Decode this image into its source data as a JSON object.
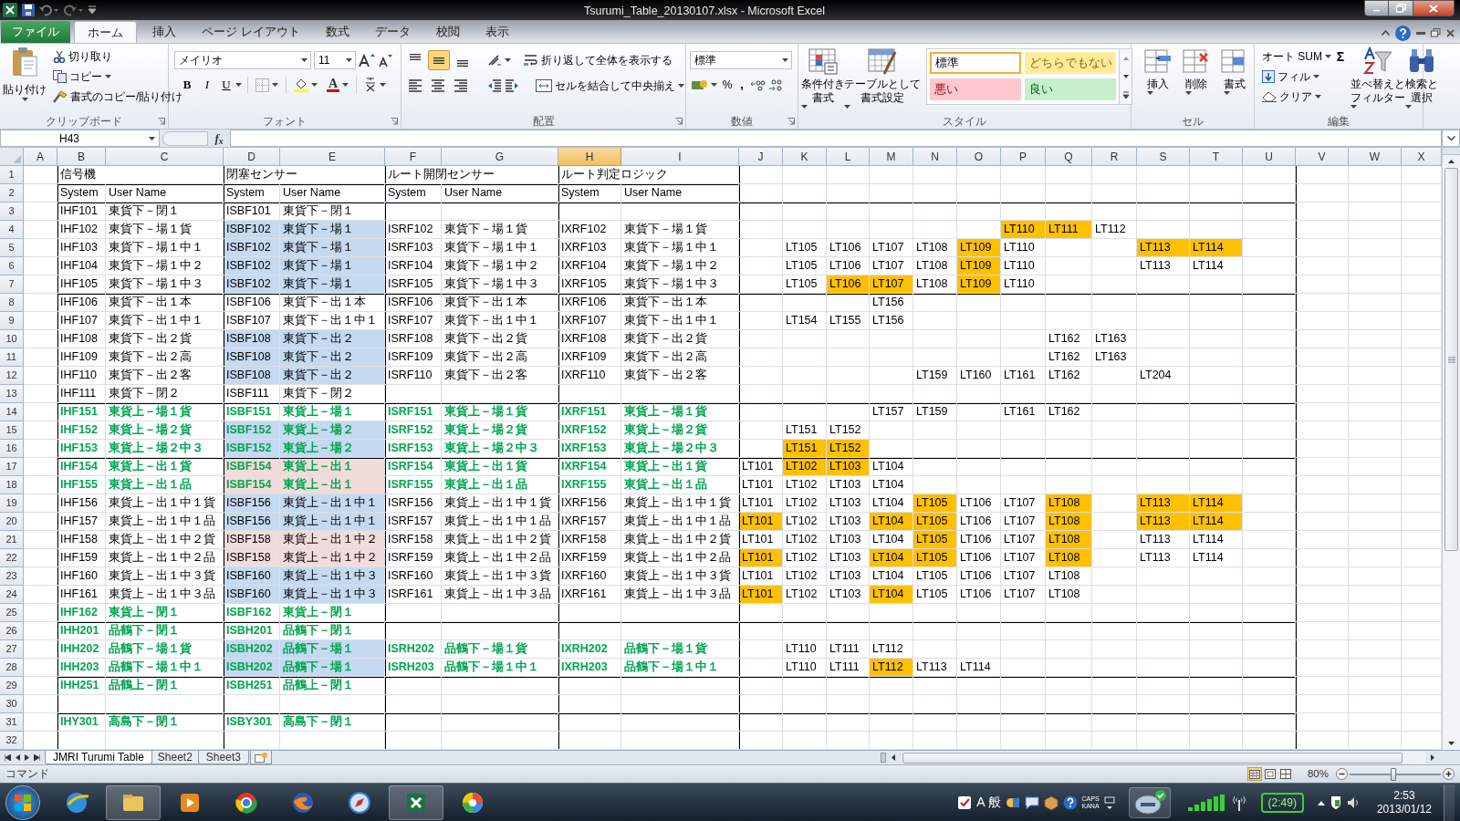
{
  "window": {
    "title": "Tsurumi_Table_20130107.xlsx  -  Microsoft Excel"
  },
  "tabs": [
    {
      "label": "ファイル",
      "selected": false,
      "kind": "file"
    },
    {
      "label": "ホーム",
      "selected": true
    },
    {
      "label": "挿入",
      "selected": false
    },
    {
      "label": "ページ レイアウト",
      "selected": false
    },
    {
      "label": "数式",
      "selected": false
    },
    {
      "label": "データ",
      "selected": false
    },
    {
      "label": "校閲",
      "selected": false
    },
    {
      "label": "表示",
      "selected": false
    }
  ],
  "ribbon": {
    "clipboard": {
      "label": "クリップボード",
      "paste": "貼り付け",
      "cut": "切り取り",
      "copy": "コピー",
      "painter": "書式のコピー/貼り付け"
    },
    "font": {
      "label": "フォント",
      "name": "メイリオ",
      "size": "11",
      "bold": "B",
      "italic": "I",
      "underline": "U",
      "color_letter": "A"
    },
    "alignment": {
      "label": "配置",
      "wrap": "折り返して全体を表示する",
      "merge": "セルを結合して中央揃え",
      "middle_on": true
    },
    "number": {
      "label": "数値",
      "format": "標準",
      "percent": "%",
      "comma": ","
    },
    "styles": {
      "label": "スタイル",
      "conditional": [
        "条件付き",
        "書式"
      ],
      "table": [
        "テーブルとして",
        "書式設定"
      ],
      "gallery": [
        {
          "text": "標準",
          "color": "#ffffff",
          "kind": "normal",
          "selected": true
        },
        {
          "text": "どちらでもない",
          "color": "#ffeb9c",
          "kind": "neutral",
          "selected": false
        },
        {
          "text": "悪い",
          "color": "#ffc7ce",
          "kind": "bad",
          "selected": false
        },
        {
          "text": "良い",
          "color": "#c6efce",
          "kind": "good",
          "selected": false
        }
      ]
    },
    "cells": {
      "label": "セル",
      "insert": "挿入",
      "delete": "削除",
      "format": "書式"
    },
    "editing": {
      "label": "編集",
      "sigma": "Σ",
      "autosum": "オート SUM",
      "fill": "フィル",
      "clear": "クリア",
      "sort": [
        "並べ替えと",
        "フィルター"
      ],
      "find": [
        "検索と",
        "選択"
      ]
    }
  },
  "formula_bar": {
    "name_box": "H43",
    "fx": "f$_{x}$"
  },
  "columns": [
    {
      "label": "A",
      "selected": false
    },
    {
      "label": "B",
      "selected": false,
      "rule_left": true
    },
    {
      "label": "C",
      "selected": false
    },
    {
      "label": "D",
      "selected": false,
      "rule_left": true
    },
    {
      "label": "E",
      "selected": false
    },
    {
      "label": "F",
      "selected": false,
      "rule_left": true
    },
    {
      "label": "G",
      "selected": false
    },
    {
      "label": "H",
      "selected": true,
      "rule_left": true
    },
    {
      "label": "I",
      "selected": false
    },
    {
      "label": "J",
      "selected": false,
      "rule_left": true
    },
    {
      "label": "K",
      "selected": false
    },
    {
      "label": "L",
      "selected": false
    },
    {
      "label": "M",
      "selected": false
    },
    {
      "label": "N",
      "selected": false
    },
    {
      "label": "O",
      "selected": false
    },
    {
      "label": "P",
      "selected": false
    },
    {
      "label": "Q",
      "selected": false
    },
    {
      "label": "R",
      "selected": false
    },
    {
      "label": "S",
      "selected": false
    },
    {
      "label": "T",
      "selected": false
    },
    {
      "label": "U",
      "selected": false
    },
    {
      "label": "V",
      "selected": false,
      "rule_left": true
    },
    {
      "label": "W",
      "selected": false
    },
    {
      "label": "X",
      "selected": false
    }
  ],
  "rows": [
    {
      "num": "1",
      "kind": "title",
      "cells": [
        null,
        "信号機",
        null,
        "閉塞センサー",
        null,
        "ルート開閉センサー",
        null,
        "ルート判定ロジック"
      ]
    },
    {
      "num": "2",
      "kind": "header",
      "rule_above": true,
      "cells": [
        null,
        "System",
        "User Name",
        "System",
        "User Name",
        "System",
        "User Name",
        "System",
        "User Name"
      ]
    },
    {
      "num": "3",
      "rule_above": true,
      "cells": [
        null,
        "IHF101",
        "東貨下－閉１",
        "ISBF101",
        "東貨下－閉１"
      ]
    },
    {
      "num": "4",
      "cells": [
        null,
        "IHF102",
        "東貨下－場１貨",
        {
          "text": "ISBF102",
          "color": "#c5d9f1"
        },
        {
          "text": "東貨下－場１",
          "color": "#c5d9f1"
        },
        "ISRF102",
        "東貨下－場１貨",
        "IXRF102",
        "東貨下－場１貨",
        null,
        null,
        null,
        null,
        null,
        null,
        {
          "text": "LT110",
          "color": "#ffc000"
        },
        {
          "text": "LT111",
          "color": "#ffc000"
        },
        "LT112"
      ]
    },
    {
      "num": "5",
      "cells": [
        null,
        "IHF103",
        "東貨下－場１中１",
        {
          "text": "ISBF102",
          "color": "#c5d9f1"
        },
        {
          "text": "東貨下－場１",
          "color": "#c5d9f1"
        },
        "ISRF103",
        "東貨下－場１中１",
        "IXRF103",
        "東貨下－場１中１",
        null,
        "LT105",
        "LT106",
        "LT107",
        "LT108",
        {
          "text": "LT109",
          "color": "#ffc000"
        },
        "LT110",
        null,
        null,
        {
          "text": "LT113",
          "color": "#ffc000"
        },
        {
          "text": "LT114",
          "color": "#ffc000"
        }
      ]
    },
    {
      "num": "6",
      "cells": [
        null,
        "IHF104",
        "東貨下－場１中２",
        {
          "text": "ISBF102",
          "color": "#c5d9f1"
        },
        {
          "text": "東貨下－場１",
          "color": "#c5d9f1"
        },
        "ISRF104",
        "東貨下－場１中２",
        "IXRF104",
        "東貨下－場１中２",
        null,
        "LT105",
        "LT106",
        "LT107",
        "LT108",
        {
          "text": "LT109",
          "color": "#ffc000"
        },
        "LT110",
        null,
        null,
        "LT113",
        "LT114"
      ]
    },
    {
      "num": "7",
      "cells": [
        null,
        "IHF105",
        "東貨下－場１中３",
        {
          "text": "ISBF102",
          "color": "#c5d9f1"
        },
        {
          "text": "東貨下－場１",
          "color": "#c5d9f1"
        },
        "ISRF105",
        "東貨下－場１中３",
        "IXRF105",
        "東貨下－場１中３",
        null,
        "LT105",
        {
          "text": "LT106",
          "color": "#ffc000"
        },
        {
          "text": "LT107",
          "color": "#ffc000"
        },
        "LT108",
        {
          "text": "LT109",
          "color": "#ffc000"
        },
        "LT110"
      ]
    },
    {
      "num": "8",
      "rule_above": true,
      "cells": [
        null,
        "IHF106",
        "東貨下－出１本",
        "ISBF106",
        "東貨下－出１本",
        "ISRF106",
        "東貨下－出１本",
        "IXRF106",
        "東貨下－出１本",
        null,
        null,
        null,
        "LT156"
      ]
    },
    {
      "num": "9",
      "cells": [
        null,
        "IHF107",
        "東貨下－出１中１",
        "ISBF107",
        "東貨下－出１中１",
        "ISRF107",
        "東貨下－出１中１",
        "IXRF107",
        "東貨下－出１中１",
        null,
        "LT154",
        "LT155",
        "LT156"
      ]
    },
    {
      "num": "10",
      "cells": [
        null,
        "IHF108",
        "東貨下－出２貨",
        {
          "text": "ISBF108",
          "color": "#c5d9f1"
        },
        {
          "text": "東貨下－出２",
          "color": "#c5d9f1"
        },
        "ISRF108",
        "東貨下－出２貨",
        "IXRF108",
        "東貨下－出２貨",
        null,
        null,
        null,
        null,
        null,
        null,
        null,
        "LT162",
        "LT163"
      ]
    },
    {
      "num": "11",
      "cells": [
        null,
        "IHF109",
        "東貨下－出２高",
        {
          "text": "ISBF108",
          "color": "#c5d9f1"
        },
        {
          "text": "東貨下－出２",
          "color": "#c5d9f1"
        },
        "ISRF109",
        "東貨下－出２高",
        "IXRF109",
        "東貨下－出２高",
        null,
        null,
        null,
        null,
        null,
        null,
        null,
        "LT162",
        "LT163"
      ]
    },
    {
      "num": "12",
      "cells": [
        null,
        "IHF110",
        "東貨下－出２客",
        {
          "text": "ISBF108",
          "color": "#c5d9f1"
        },
        {
          "text": "東貨下－出２",
          "color": "#c5d9f1"
        },
        "ISRF110",
        "東貨下－出２客",
        "IXRF110",
        "東貨下－出２客",
        null,
        null,
        null,
        null,
        "LT159",
        "LT160",
        "LT161",
        "LT162",
        null,
        "LT204"
      ]
    },
    {
      "num": "13",
      "cells": [
        null,
        "IHF111",
        "東貨下－閉２",
        "ISBF111",
        "東貨下－閉２"
      ]
    },
    {
      "num": "14",
      "rule_above": true,
      "cells": [
        null,
        {
          "text": "IHF151",
          "kind": "accent"
        },
        {
          "text": "東貨上－場１貨",
          "kind": "accent"
        },
        {
          "text": "ISBF151",
          "kind": "accent"
        },
        {
          "text": "東貨上－場１",
          "kind": "accent"
        },
        {
          "text": "ISRF151",
          "kind": "accent"
        },
        {
          "text": "東貨上－場１貨",
          "kind": "accent"
        },
        {
          "text": "IXRF151",
          "kind": "accent"
        },
        {
          "text": "東貨上－場１貨",
          "kind": "accent"
        },
        null,
        null,
        null,
        "LT157",
        "LT159",
        null,
        "LT161",
        "LT162"
      ]
    },
    {
      "num": "15",
      "cells": [
        null,
        {
          "text": "IHF152",
          "kind": "accent"
        },
        {
          "text": "東貨上－場２貨",
          "kind": "accent"
        },
        {
          "text": "ISBF152",
          "kind": "accent",
          "color": "#c5d9f1"
        },
        {
          "text": "東貨上－場２",
          "kind": "accent",
          "color": "#c5d9f1"
        },
        {
          "text": "ISRF152",
          "kind": "accent"
        },
        {
          "text": "東貨上－場２貨",
          "kind": "accent"
        },
        {
          "text": "IXRF152",
          "kind": "accent"
        },
        {
          "text": "東貨上－場２貨",
          "kind": "accent"
        },
        null,
        "LT151",
        "LT152"
      ]
    },
    {
      "num": "16",
      "cells": [
        null,
        {
          "text": "IHF153",
          "kind": "accent"
        },
        {
          "text": "東貨上－場２中３",
          "kind": "accent"
        },
        {
          "text": "ISBF152",
          "kind": "accent",
          "color": "#c5d9f1"
        },
        {
          "text": "東貨上－場２",
          "kind": "accent",
          "color": "#c5d9f1"
        },
        {
          "text": "ISRF153",
          "kind": "accent"
        },
        {
          "text": "東貨上－場２中３",
          "kind": "accent"
        },
        {
          "text": "IXRF153",
          "kind": "accent"
        },
        {
          "text": "東貨上－場２中３",
          "kind": "accent"
        },
        null,
        {
          "text": "LT151",
          "color": "#ffc000"
        },
        {
          "text": "LT152",
          "color": "#ffc000"
        }
      ]
    },
    {
      "num": "17",
      "rule_above": true,
      "cells": [
        null,
        {
          "text": "IHF154",
          "kind": "accent"
        },
        {
          "text": "東貨上－出１貨",
          "kind": "accent"
        },
        {
          "text": "ISBF154",
          "kind": "accent",
          "color": "#f2dcdb"
        },
        {
          "text": "東貨上－出１",
          "kind": "accent",
          "color": "#f2dcdb"
        },
        {
          "text": "ISRF154",
          "kind": "accent"
        },
        {
          "text": "東貨上－出１貨",
          "kind": "accent"
        },
        {
          "text": "IXRF154",
          "kind": "accent"
        },
        {
          "text": "東貨上－出１貨",
          "kind": "accent"
        },
        "LT101",
        {
          "text": "LT102",
          "color": "#ffc000"
        },
        {
          "text": "LT103",
          "color": "#ffc000"
        },
        "LT104"
      ]
    },
    {
      "num": "18",
      "cells": [
        null,
        {
          "text": "IHF155",
          "kind": "accent"
        },
        {
          "text": "東貨上－出１品",
          "kind": "accent"
        },
        {
          "text": "ISBF154",
          "kind": "accent",
          "color": "#f2dcdb"
        },
        {
          "text": "東貨上－出１",
          "kind": "accent",
          "color": "#f2dcdb"
        },
        {
          "text": "ISRF155",
          "kind": "accent"
        },
        {
          "text": "東貨上－出１品",
          "kind": "accent"
        },
        {
          "text": "IXRF155",
          "kind": "accent"
        },
        {
          "text": "東貨上－出１品",
          "kind": "accent"
        },
        "LT101",
        "LT102",
        "LT103",
        "LT104"
      ]
    },
    {
      "num": "19",
      "cells": [
        null,
        "IHF156",
        "東貨上－出１中１貨",
        {
          "text": "ISBF156",
          "color": "#c5d9f1"
        },
        {
          "text": "東貨上－出１中１",
          "color": "#c5d9f1"
        },
        "ISRF156",
        "東貨上－出１中１貨",
        "IXRF156",
        "東貨上－出１中１貨",
        "LT101",
        "LT102",
        "LT103",
        "LT104",
        {
          "text": "LT105",
          "color": "#ffc000"
        },
        "LT106",
        "LT107",
        {
          "text": "LT108",
          "color": "#ffc000"
        },
        null,
        {
          "text": "LT113",
          "color": "#ffc000"
        },
        {
          "text": "LT114",
          "color": "#ffc000"
        }
      ]
    },
    {
      "num": "20",
      "cells": [
        null,
        "IHF157",
        "東貨上－出１中１品",
        {
          "text": "ISBF156",
          "color": "#c5d9f1"
        },
        {
          "text": "東貨上－出１中１",
          "color": "#c5d9f1"
        },
        "ISRF157",
        "東貨上－出１中１品",
        "IXRF157",
        "東貨上－出１中１品",
        {
          "text": "LT101",
          "color": "#ffc000"
        },
        "LT102",
        "LT103",
        {
          "text": "LT104",
          "color": "#ffc000"
        },
        {
          "text": "LT105",
          "color": "#ffc000"
        },
        "LT106",
        "LT107",
        {
          "text": "LT108",
          "color": "#ffc000"
        },
        null,
        {
          "text": "LT113",
          "color": "#ffc000"
        },
        {
          "text": "LT114",
          "color": "#ffc000"
        }
      ]
    },
    {
      "num": "21",
      "cells": [
        null,
        "IHF158",
        "東貨上－出１中２貨",
        {
          "text": "ISBF158",
          "color": "#f2dcdb"
        },
        {
          "text": "東貨上－出１中２",
          "color": "#f2dcdb"
        },
        "ISRF158",
        "東貨上－出１中２貨",
        "IXRF158",
        "東貨上－出１中２貨",
        "LT101",
        "LT102",
        "LT103",
        "LT104",
        {
          "text": "LT105",
          "color": "#ffc000"
        },
        "LT106",
        "LT107",
        {
          "text": "LT108",
          "color": "#ffc000"
        },
        null,
        "LT113",
        "LT114"
      ]
    },
    {
      "num": "22",
      "cells": [
        null,
        "IHF159",
        "東貨上－出１中２品",
        {
          "text": "ISBF158",
          "color": "#f2dcdb"
        },
        {
          "text": "東貨上－出１中２",
          "color": "#f2dcdb"
        },
        "ISRF159",
        "東貨上－出１中２品",
        "IXRF159",
        "東貨上－出１中２品",
        {
          "text": "LT101",
          "color": "#ffc000"
        },
        "LT102",
        "LT103",
        {
          "text": "LT104",
          "color": "#ffc000"
        },
        {
          "text": "LT105",
          "color": "#ffc000"
        },
        "LT106",
        "LT107",
        {
          "text": "LT108",
          "color": "#ffc000"
        },
        null,
        "LT113",
        "LT114"
      ]
    },
    {
      "num": "23",
      "cells": [
        null,
        "IHF160",
        "東貨上－出１中３貨",
        {
          "text": "ISBF160",
          "color": "#c5d9f1"
        },
        {
          "text": "東貨上－出１中３",
          "color": "#c5d9f1"
        },
        "ISRF160",
        "東貨上－出１中３貨",
        "IXRF160",
        "東貨上－出１中３貨",
        "LT101",
        "LT102",
        "LT103",
        "LT104",
        "LT105",
        "LT106",
        "LT107",
        "LT108"
      ]
    },
    {
      "num": "24",
      "cells": [
        null,
        "IHF161",
        "東貨上－出１中３品",
        {
          "text": "ISBF160",
          "color": "#c5d9f1"
        },
        {
          "text": "東貨上－出１中３",
          "color": "#c5d9f1"
        },
        "ISRF161",
        "東貨上－出１中３品",
        "IXRF161",
        "東貨上－出１中３品",
        {
          "text": "LT101",
          "color": "#ffc000"
        },
        "LT102",
        "LT103",
        {
          "text": "LT104",
          "color": "#ffc000"
        },
        "LT105",
        "LT106",
        "LT107",
        "LT108"
      ]
    },
    {
      "num": "25",
      "cells": [
        null,
        {
          "text": "IHF162",
          "kind": "accent"
        },
        {
          "text": "東貨上－閉１",
          "kind": "accent"
        },
        {
          "text": "ISBF162",
          "kind": "accent"
        },
        {
          "text": "東貨上－閉１",
          "kind": "accent"
        }
      ]
    },
    {
      "num": "26",
      "rule_above": true,
      "cells": [
        null,
        {
          "text": "IHH201",
          "kind": "accent"
        },
        {
          "text": "品鶴下－閉１",
          "kind": "accent"
        },
        {
          "text": "ISBH201",
          "kind": "accent"
        },
        {
          "text": "品鶴下－閉１",
          "kind": "accent"
        }
      ]
    },
    {
      "num": "27",
      "cells": [
        null,
        {
          "text": "IHH202",
          "kind": "accent"
        },
        {
          "text": "品鶴下－場１貨",
          "kind": "accent"
        },
        {
          "text": "ISBH202",
          "kind": "accent",
          "color": "#c5d9f1"
        },
        {
          "text": "品鶴下－場１",
          "kind": "accent",
          "color": "#c5d9f1"
        },
        {
          "text": "ISRH202",
          "kind": "accent"
        },
        {
          "text": "品鶴下－場１貨",
          "kind": "accent"
        },
        {
          "text": "IXRH202",
          "kind": "accent"
        },
        {
          "text": "品鶴下－場１貨",
          "kind": "accent"
        },
        null,
        "LT110",
        "LT111",
        "LT112"
      ]
    },
    {
      "num": "28",
      "cells": [
        null,
        {
          "text": "IHH203",
          "kind": "accent"
        },
        {
          "text": "品鶴下－場１中１",
          "kind": "accent"
        },
        {
          "text": "ISBH202",
          "kind": "accent",
          "color": "#c5d9f1"
        },
        {
          "text": "品鶴下－場１",
          "kind": "accent",
          "color": "#c5d9f1"
        },
        {
          "text": "ISRH203",
          "kind": "accent"
        },
        {
          "text": "品鶴下－場１中１",
          "kind": "accent"
        },
        {
          "text": "IXRH203",
          "kind": "accent"
        },
        {
          "text": "品鶴下－場１中１",
          "kind": "accent"
        },
        null,
        "LT110",
        "LT111",
        {
          "text": "LT112",
          "color": "#ffc000"
        },
        "LT113",
        "LT114"
      ]
    },
    {
      "num": "29",
      "rule_above": true,
      "cells": [
        null,
        {
          "text": "IHH251",
          "kind": "accent"
        },
        {
          "text": "品鶴上－閉１",
          "kind": "accent"
        },
        {
          "text": "ISBH251",
          "kind": "accent"
        },
        {
          "text": "品鶴上－閉１",
          "kind": "accent"
        }
      ]
    },
    {
      "num": "30"
    },
    {
      "num": "31",
      "rule_above": true,
      "cells": [
        null,
        {
          "text": "IHY301",
          "kind": "accent"
        },
        {
          "text": "高島下－閉１",
          "kind": "accent"
        },
        {
          "text": "ISBY301",
          "kind": "accent"
        },
        {
          "text": "高島下－閉１",
          "kind": "accent"
        }
      ]
    },
    {
      "num": "32"
    }
  ],
  "sheet_tabs": [
    {
      "label": "JMRI Turumi Table",
      "selected": true
    },
    {
      "label": "Sheet2",
      "selected": false
    },
    {
      "label": "Sheet3",
      "selected": false
    }
  ],
  "status_bar": {
    "mode": "コマンド",
    "zoom": "80%",
    "zoom_level": {
      "level": 0.48
    }
  },
  "taskbar": {
    "ime": [
      "A",
      "般"
    ],
    "caps": "CAPS",
    "kana": "KANA",
    "battery": "(2:49)",
    "time": "2:53",
    "date": "2013/01/12"
  }
}
